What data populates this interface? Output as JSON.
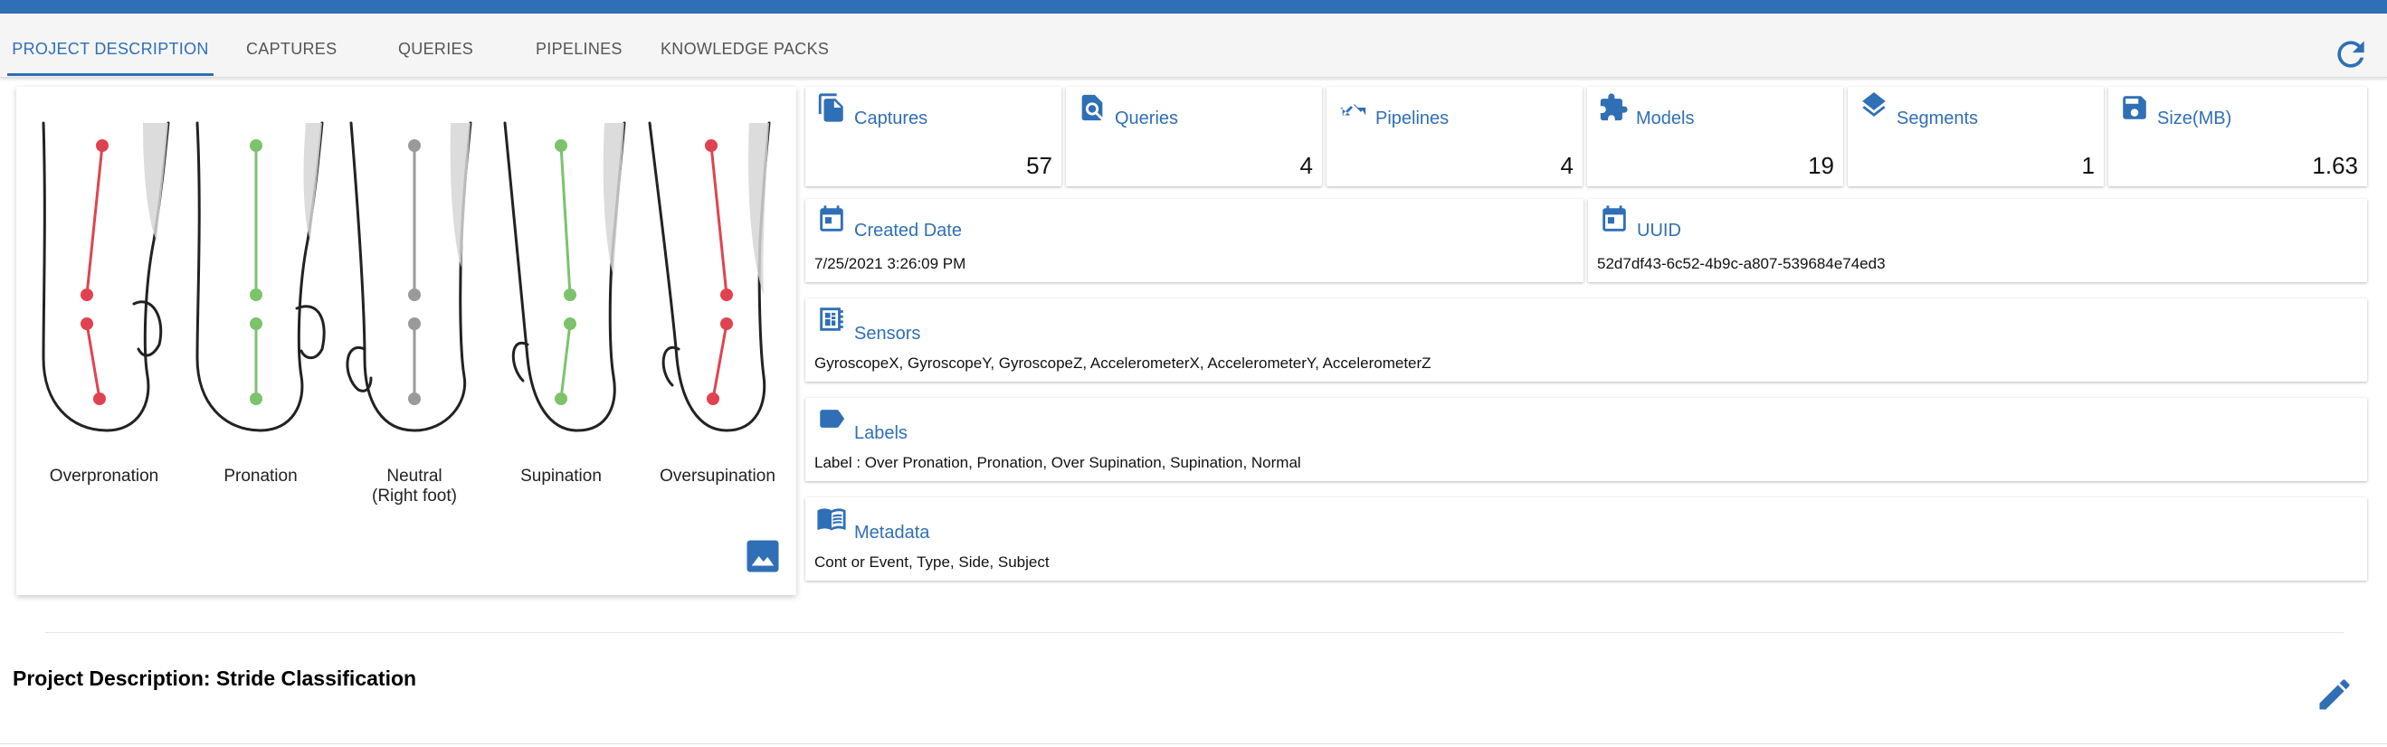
{
  "tabs": [
    {
      "label": "PROJECT DESCRIPTION"
    },
    {
      "label": "CAPTURES"
    },
    {
      "label": "QUERIES"
    },
    {
      "label": "PIPELINES"
    },
    {
      "label": "KNOWLEDGE PACKS"
    }
  ],
  "illustration": {
    "labels": [
      "Overpronation",
      "Pronation",
      "Neutral",
      "(Right foot)",
      "Supination",
      "Oversupination"
    ]
  },
  "stats": [
    {
      "label": "Captures",
      "value": "57",
      "icon": "file-copy-icon"
    },
    {
      "label": "Queries",
      "value": "4",
      "icon": "find-in-page-icon"
    },
    {
      "label": "Pipelines",
      "value": "4",
      "icon": "fork-icon"
    },
    {
      "label": "Models",
      "value": "19",
      "icon": "puzzle-icon"
    },
    {
      "label": "Segments",
      "value": "1",
      "icon": "layers-icon"
    },
    {
      "label": "Size(MB)",
      "value": "1.63",
      "icon": "floppy-icon"
    }
  ],
  "created": {
    "label": "Created Date",
    "value": "7/25/2021 3:26:09 PM"
  },
  "uuid": {
    "label": "UUID",
    "value": "52d7df43-6c52-4b9c-a807-539684e74ed3"
  },
  "sensors": {
    "label": "Sensors",
    "value": "GyroscopeX, GyroscopeY, GyroscopeZ, AccelerometerX, AccelerometerY, AccelerometerZ"
  },
  "labels": {
    "label": "Labels",
    "value": "Label : Over Pronation, Pronation, Over Supination, Supination, Normal"
  },
  "metadata": {
    "label": "Metadata",
    "value": "Cont or Event, Type, Side, Subject"
  },
  "description": {
    "text": "Project Description: Stride Classification"
  },
  "colors": {
    "accent": "#2f6fb5",
    "red": "#e0434f",
    "green": "#7cc36c",
    "gray": "#9a9a9a"
  }
}
